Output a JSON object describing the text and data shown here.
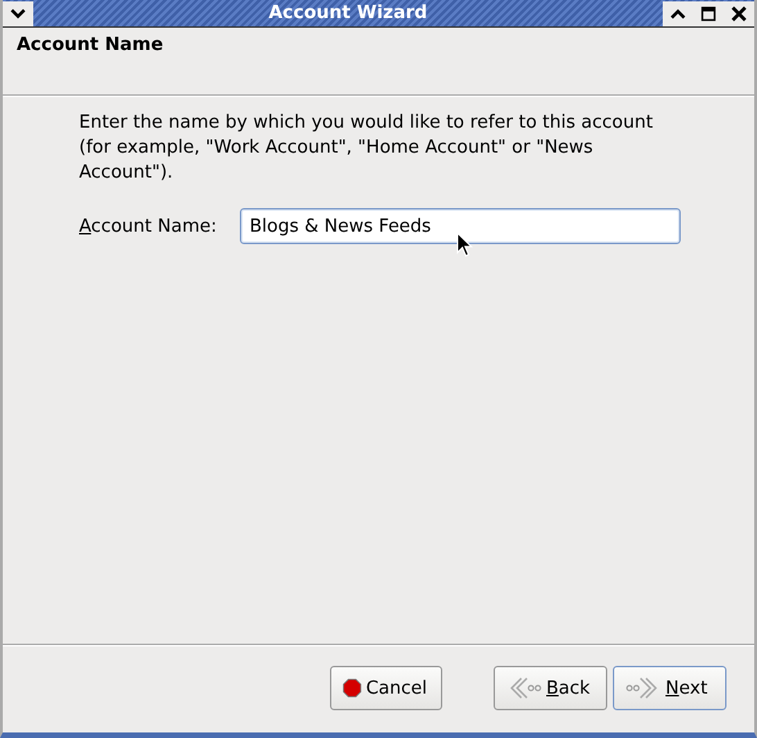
{
  "window": {
    "title": "Account Wizard"
  },
  "header": {
    "title": "Account Name"
  },
  "description": "Enter the name by which you would like to refer to this account (for example, \"Work Account\", \"Home Account\" or \"News Account\").",
  "field": {
    "label": "Account Name:",
    "mnemonic": true,
    "value": "Blogs & News Feeds",
    "focused": true
  },
  "buttons": [
    {
      "kind": "cancel",
      "label": "Cancel",
      "mnemonic": false,
      "focused": false
    },
    {
      "kind": "back",
      "label": "Back",
      "mnemonic": true,
      "focused": false
    },
    {
      "kind": "next",
      "label": "Next",
      "mnemonic": true,
      "focused": true
    }
  ]
}
